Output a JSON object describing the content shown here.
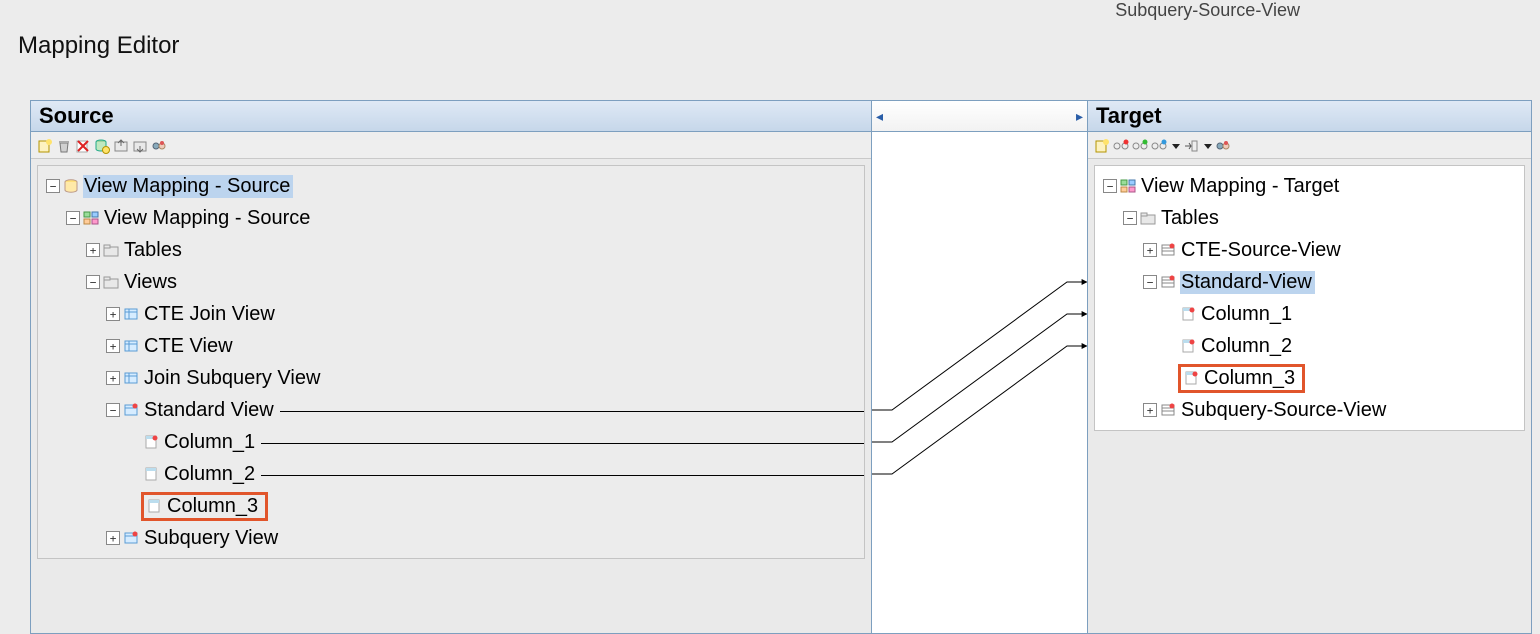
{
  "remnant_tab": "Subquery-Source-View",
  "window_title": "Mapping Editor",
  "source": {
    "header": "Source",
    "toolbar": [
      "new",
      "trash",
      "delete-x",
      "db-add",
      "export",
      "import",
      "settings"
    ],
    "tree": [
      {
        "id": "s0",
        "depth": 0,
        "exp": "-",
        "icon": "db",
        "label": "View Mapping - Source",
        "selected": true
      },
      {
        "id": "s1",
        "depth": 1,
        "exp": "-",
        "icon": "schema",
        "label": "View Mapping - Source"
      },
      {
        "id": "s2",
        "depth": 2,
        "exp": "+",
        "icon": "folder",
        "label": "Tables"
      },
      {
        "id": "s3",
        "depth": 2,
        "exp": "-",
        "icon": "folder",
        "label": "Views"
      },
      {
        "id": "s4",
        "depth": 3,
        "exp": "+",
        "icon": "view",
        "label": "CTE Join View"
      },
      {
        "id": "s5",
        "depth": 3,
        "exp": "+",
        "icon": "view",
        "label": "CTE View"
      },
      {
        "id": "s6",
        "depth": 3,
        "exp": "+",
        "icon": "view",
        "label": "Join Subquery View"
      },
      {
        "id": "s7",
        "depth": 3,
        "exp": "-",
        "icon": "view-red",
        "label": "Standard View"
      },
      {
        "id": "s8",
        "depth": 4,
        "exp": "",
        "icon": "col-red",
        "label": "Column_1"
      },
      {
        "id": "s9",
        "depth": 4,
        "exp": "",
        "icon": "col",
        "label": "Column_2"
      },
      {
        "id": "s10",
        "depth": 4,
        "exp": "",
        "icon": "col",
        "label": "Column_3",
        "highlight": true
      },
      {
        "id": "s11",
        "depth": 3,
        "exp": "+",
        "icon": "view-red",
        "label": "Subquery View"
      }
    ]
  },
  "target": {
    "header": "Target",
    "toolbar": [
      "new",
      "map-red",
      "map-green",
      "map-blue",
      "dd",
      "pick",
      "dd",
      "settings"
    ],
    "tree": [
      {
        "id": "t0",
        "depth": 0,
        "exp": "-",
        "icon": "schema",
        "label": "View Mapping - Target"
      },
      {
        "id": "t1",
        "depth": 1,
        "exp": "-",
        "icon": "folder",
        "label": "Tables"
      },
      {
        "id": "t2",
        "depth": 2,
        "exp": "+",
        "icon": "tbl-red",
        "label": "CTE-Source-View"
      },
      {
        "id": "t3",
        "depth": 2,
        "exp": "-",
        "icon": "tbl-red",
        "label": "Standard-View",
        "selected": true
      },
      {
        "id": "t4",
        "depth": 3,
        "exp": "",
        "icon": "col-red",
        "label": "Column_1"
      },
      {
        "id": "t5",
        "depth": 3,
        "exp": "",
        "icon": "col-red",
        "label": "Column_2"
      },
      {
        "id": "t6",
        "depth": 3,
        "exp": "",
        "icon": "col-red",
        "label": "Column_3",
        "highlight": true
      },
      {
        "id": "t7",
        "depth": 2,
        "exp": "+",
        "icon": "tbl-red",
        "label": "Subquery-Source-View"
      }
    ]
  },
  "middle": {
    "left_arrow": "◂",
    "right_arrow": "▸"
  }
}
